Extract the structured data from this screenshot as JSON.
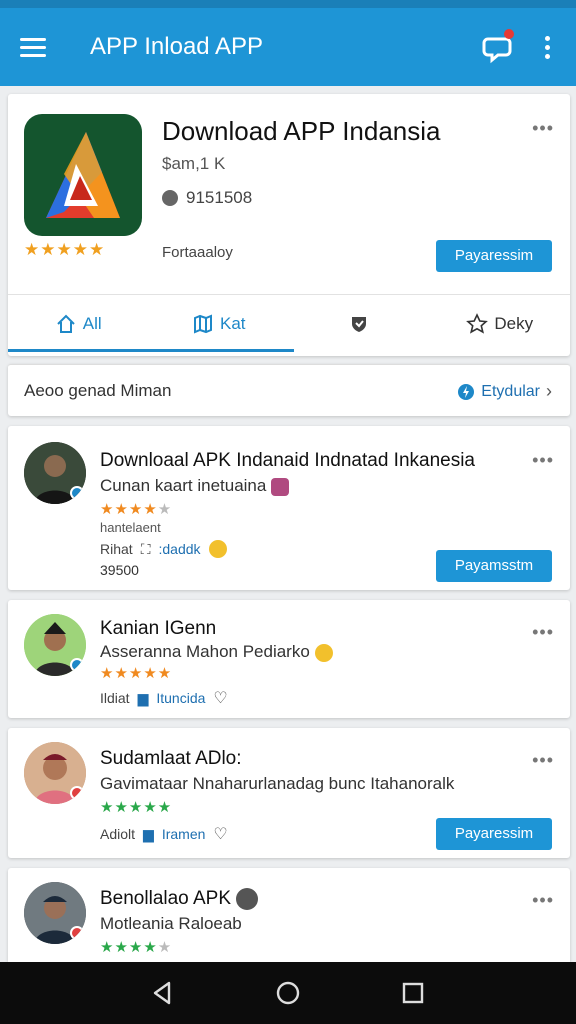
{
  "appbar": {
    "title": "APP Inload APP",
    "menu_icon": "menu-icon",
    "notification_icon": "chat-bubble-icon",
    "more_icon": "more-vertical-icon"
  },
  "hero": {
    "title": "Download APP Indansia",
    "subtitle": "$am,1 K",
    "downloads": "9151508",
    "rating_stars": "★★★★★",
    "category": "Fortaaaloy",
    "action_label": "Payaressim",
    "more": "•••"
  },
  "tabs": [
    {
      "label": "All",
      "icon": "home-icon",
      "active": true
    },
    {
      "label": "Kat",
      "icon": "map-icon",
      "active": false
    },
    {
      "label": "",
      "icon": "shield-icon",
      "active": false
    },
    {
      "label": "Deky",
      "icon": "star-outline-icon",
      "active": false
    }
  ],
  "filter": {
    "label": "Aeoo genad Miman",
    "link_label": "Etydular"
  },
  "items": [
    {
      "title": "Downloaal APK Indanaid Indnatad Inkanesia",
      "subtitle": "Cunan kaart inetuaina",
      "stars": "★★★★",
      "stars_dim": "★",
      "star_color": "#f08a20",
      "caption": "hantelaent",
      "meta_left": "Rihat",
      "meta_link": ":daddk",
      "count": "39500",
      "action_label": "Payamsstm",
      "more": "•••"
    },
    {
      "title": "Kanian IGenn",
      "subtitle": "Asseranna Mahon Pediarko",
      "stars": "★★★★★",
      "star_color": "#f08a20",
      "meta_left": "Ildiat",
      "meta_link": "Ituncida",
      "more": "•••"
    },
    {
      "title": "Sudamlaat ADlo:",
      "subtitle": "Gavimataar Nnaharurlanadag bunc Itahanoralk",
      "stars": "★★★★★",
      "star_color": "#2aa84a",
      "meta_left": "Adiolt",
      "meta_link": "Iramen",
      "action_label": "Payaressim",
      "more": "•••"
    },
    {
      "title": "Benollalao APK",
      "subtitle": "Motleania Raloeab",
      "stars": "★★★★",
      "stars_dim": "★",
      "star_color": "#2aa84a",
      "more": "•••"
    }
  ],
  "nav": {
    "back_icon": "back-triangle-icon",
    "home_icon": "home-circle-icon",
    "recents_icon": "recents-square-icon"
  },
  "colors": {
    "appbar": "#1e95d6",
    "accent": "#1e88c8",
    "button": "#1e95d6",
    "navbar": "#0c0c0c"
  }
}
